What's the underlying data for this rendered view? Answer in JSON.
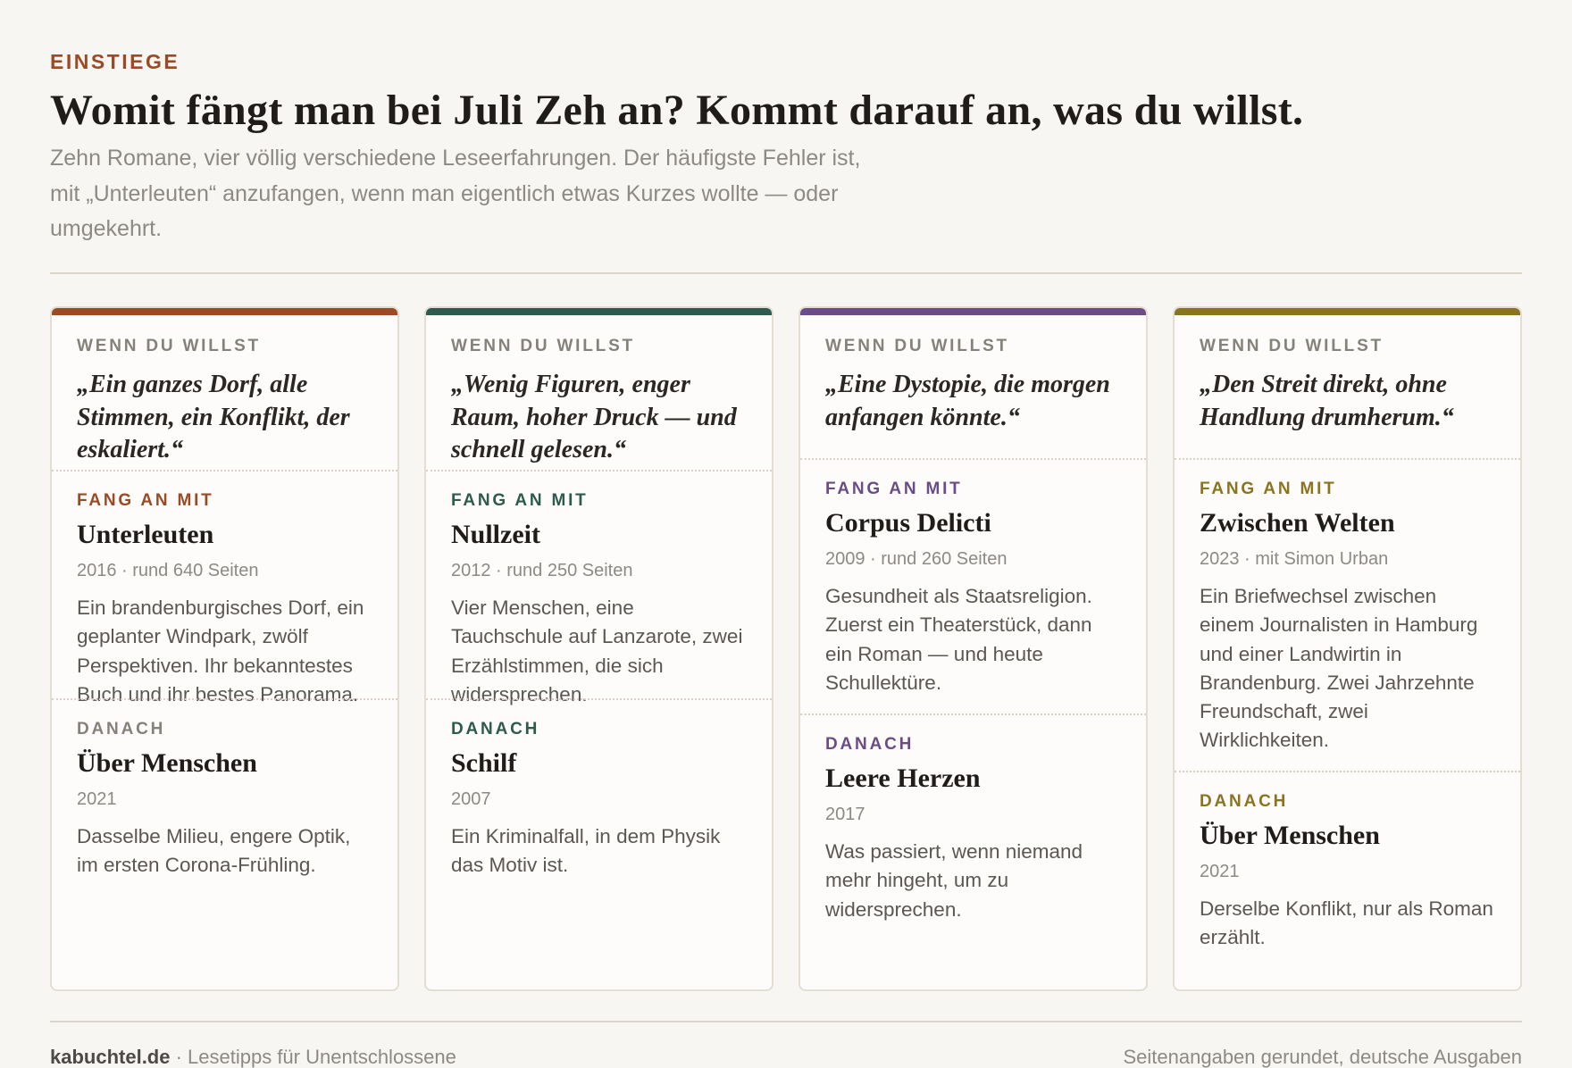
{
  "eyebrow": "EINSTIEGE",
  "headline": "Womit fängt man bei Juli Zeh an? Kommt darauf an, was du willst.",
  "intro": "Zehn Romane, vier völlig verschiedene Leseerfahrungen. Der häufigste Fehler ist, mit „Unterleuten“ anzufangen, wenn man eigentlich etwas Kurzes wollte — oder umgekehrt.",
  "labels": {
    "want": "WENN DU WILLST",
    "start": "FANG AN MIT",
    "next": "DANACH"
  },
  "colors": {
    "eyebrow": "#9a4a24",
    "rust": "#9a4a24",
    "green": "#2f5a4e",
    "purple": "#6a4c86",
    "olive": "#8a7420"
  },
  "cards": [
    {
      "accent": "#9a4a24",
      "quote": "„Ein ganzes Dorf, alle Stimmen, ein Konflikt, der eskaliert.“",
      "start": {
        "title": "Unterleuten",
        "meta": "2016 · rund 640 Seiten",
        "desc": "Ein brandenburgisches Dorf, ein geplanter Windpark, zwölf Perspektiven. Ihr bekanntestes Buch und ihr bestes Panorama."
      },
      "next": {
        "title": "Über Menschen",
        "meta": "2021",
        "desc": "Dasselbe Milieu, engere Optik, im ersten Corona-Frühling."
      }
    },
    {
      "accent": "#2f5a4e",
      "quote": "„Wenig Figuren, enger Raum, hoher Druck — und schnell gelesen.“",
      "start": {
        "title": "Nullzeit",
        "meta": "2012 · rund 250 Seiten",
        "desc": "Vier Menschen, eine Tauchschule auf Lanzarote, zwei Erzählstimmen, die sich widersprechen."
      },
      "next": {
        "title": "Schilf",
        "meta": "2007",
        "desc": "Ein Kriminalfall, in dem Physik das Motiv ist."
      }
    },
    {
      "accent": "#6a4c86",
      "quote": "„Eine Dystopie, die morgen anfangen könnte.“",
      "start": {
        "title": "Corpus Delicti",
        "meta": "2009 · rund 260 Seiten",
        "desc": "Gesundheit als Staatsreligion. Zuerst ein Theaterstück, dann ein Roman — und heute Schullektüre."
      },
      "next": {
        "title": "Leere Herzen",
        "meta": "2017",
        "desc": "Was passiert, wenn niemand mehr hingeht, um zu widersprechen."
      }
    },
    {
      "accent": "#8a7420",
      "quote": "„Den Streit direkt, ohne Handlung drumherum.“",
      "start": {
        "title": "Zwischen Welten",
        "meta": "2023 · mit Simon Urban",
        "desc": "Ein Briefwechsel zwischen einem Journalisten in Hamburg und einer Landwirtin in Brandenburg. Zwei Jahrzehnte Freundschaft, zwei Wirklichkeiten."
      },
      "next": {
        "title": "Über Menschen",
        "meta": "2021",
        "desc": "Derselbe Konflikt, nur als Roman erzählt."
      }
    }
  ],
  "footer": {
    "brand": "kabuchtel.de",
    "tagline": " · Lesetipps für Unentschlossene",
    "note": "Seitenangaben gerundet, deutsche Ausgaben"
  }
}
